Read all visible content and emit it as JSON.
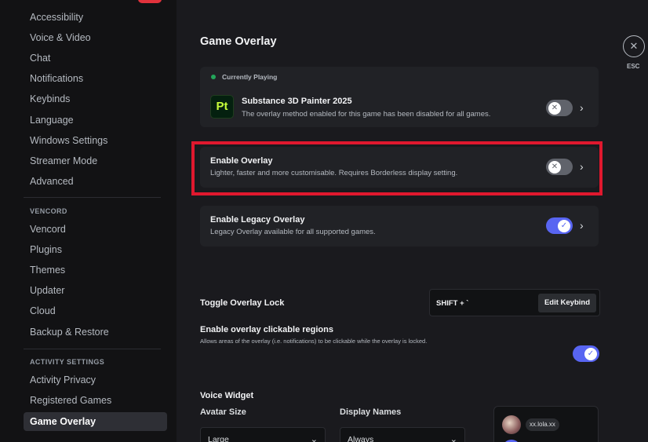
{
  "sidebar": {
    "items": [
      {
        "label": "Accessibility"
      },
      {
        "label": "Voice & Video"
      },
      {
        "label": "Chat"
      },
      {
        "label": "Notifications"
      },
      {
        "label": "Keybinds"
      },
      {
        "label": "Language"
      },
      {
        "label": "Windows Settings"
      },
      {
        "label": "Streamer Mode"
      },
      {
        "label": "Advanced"
      }
    ],
    "vencord_header": "VENCORD",
    "vencord_items": [
      {
        "label": "Vencord"
      },
      {
        "label": "Plugins"
      },
      {
        "label": "Themes"
      },
      {
        "label": "Updater"
      },
      {
        "label": "Cloud"
      },
      {
        "label": "Backup & Restore"
      }
    ],
    "activity_header": "ACTIVITY SETTINGS",
    "activity_items": [
      {
        "label": "Activity Privacy"
      },
      {
        "label": "Registered Games"
      },
      {
        "label": "Game Overlay",
        "selected": true
      }
    ]
  },
  "page": {
    "title": "Game Overlay",
    "close_label": "ESC"
  },
  "currently_playing": {
    "header": "Currently Playing",
    "app_icon_text": "Pt",
    "game_name": "Substance 3D Painter 2025",
    "description": "The overlay method enabled for this game has been disabled for all games.",
    "toggle_on": false
  },
  "enable_overlay": {
    "title": "Enable Overlay",
    "description": "Lighter, faster and more customisable. Requires Borderless display setting.",
    "toggle_on": false
  },
  "legacy_overlay": {
    "title": "Enable Legacy Overlay",
    "description": "Legacy Overlay available for all supported games.",
    "toggle_on": true
  },
  "overlay_lock": {
    "title": "Toggle Overlay Lock",
    "keybind_value": "SHIFT + `",
    "edit_button": "Edit Keybind"
  },
  "clickable_regions": {
    "title": "Enable overlay clickable regions",
    "description": "Allows areas of the overlay (i.e. notifications) to be clickable while the overlay is locked.",
    "toggle_on": true
  },
  "voice_widget": {
    "title": "Voice Widget",
    "avatar_size_label": "Avatar Size",
    "avatar_size_value": "Large",
    "display_names_label": "Display Names",
    "display_names_value": "Always",
    "preview_username": "xx.lola.xx"
  },
  "colors": {
    "accent": "#5865f2",
    "highlight_border": "#e0182e",
    "status_dot": "#23a55a"
  }
}
